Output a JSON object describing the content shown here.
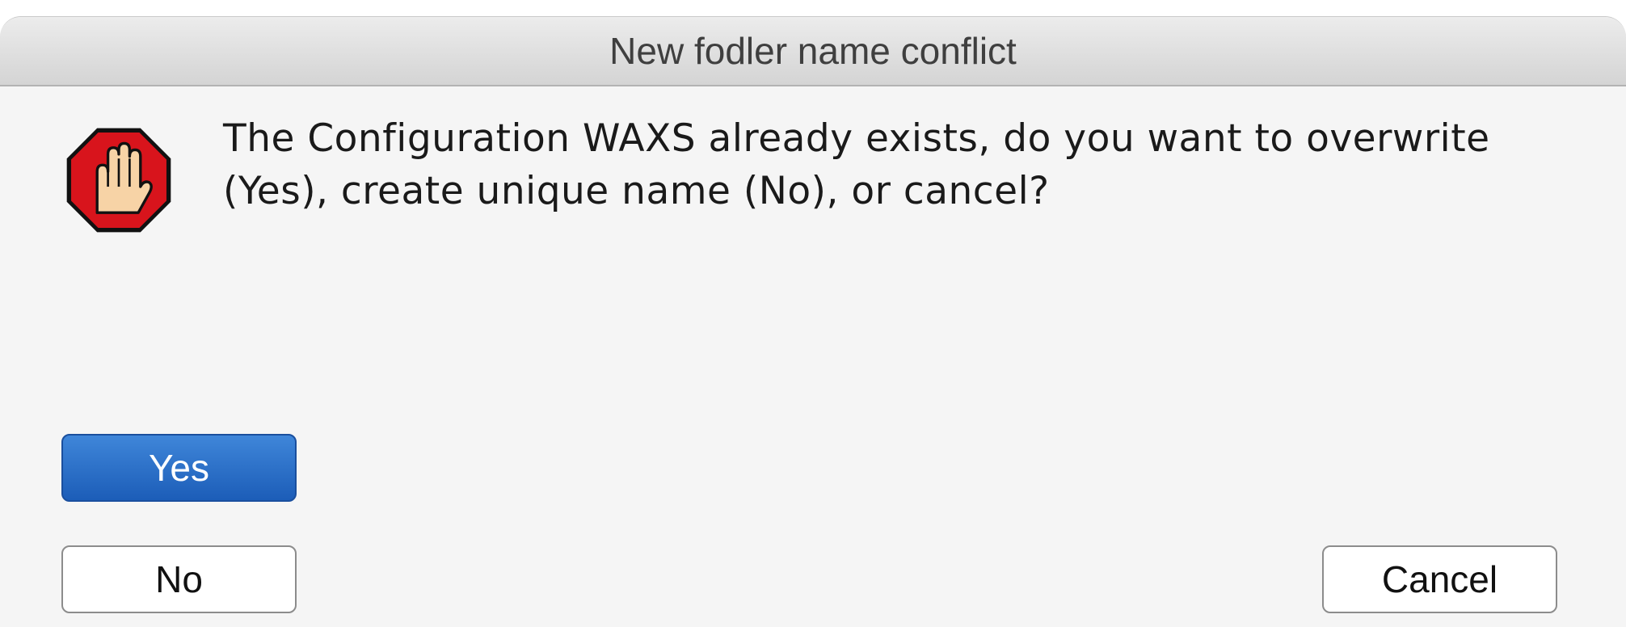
{
  "dialog": {
    "title": "New fodler name conflict",
    "icon": "stop-hand-icon",
    "message_line1": "The Configuration WAXS already exists, do you want to overwrite",
    "message_line2": "(Yes), create unique name (No), or cancel?"
  },
  "buttons": {
    "yes_label": "Yes",
    "no_label": "No",
    "cancel_label": "Cancel"
  },
  "colors": {
    "primary_button": "#2a6fcb",
    "stop_red": "#d8141c",
    "dialog_background": "#f5f5f5"
  }
}
